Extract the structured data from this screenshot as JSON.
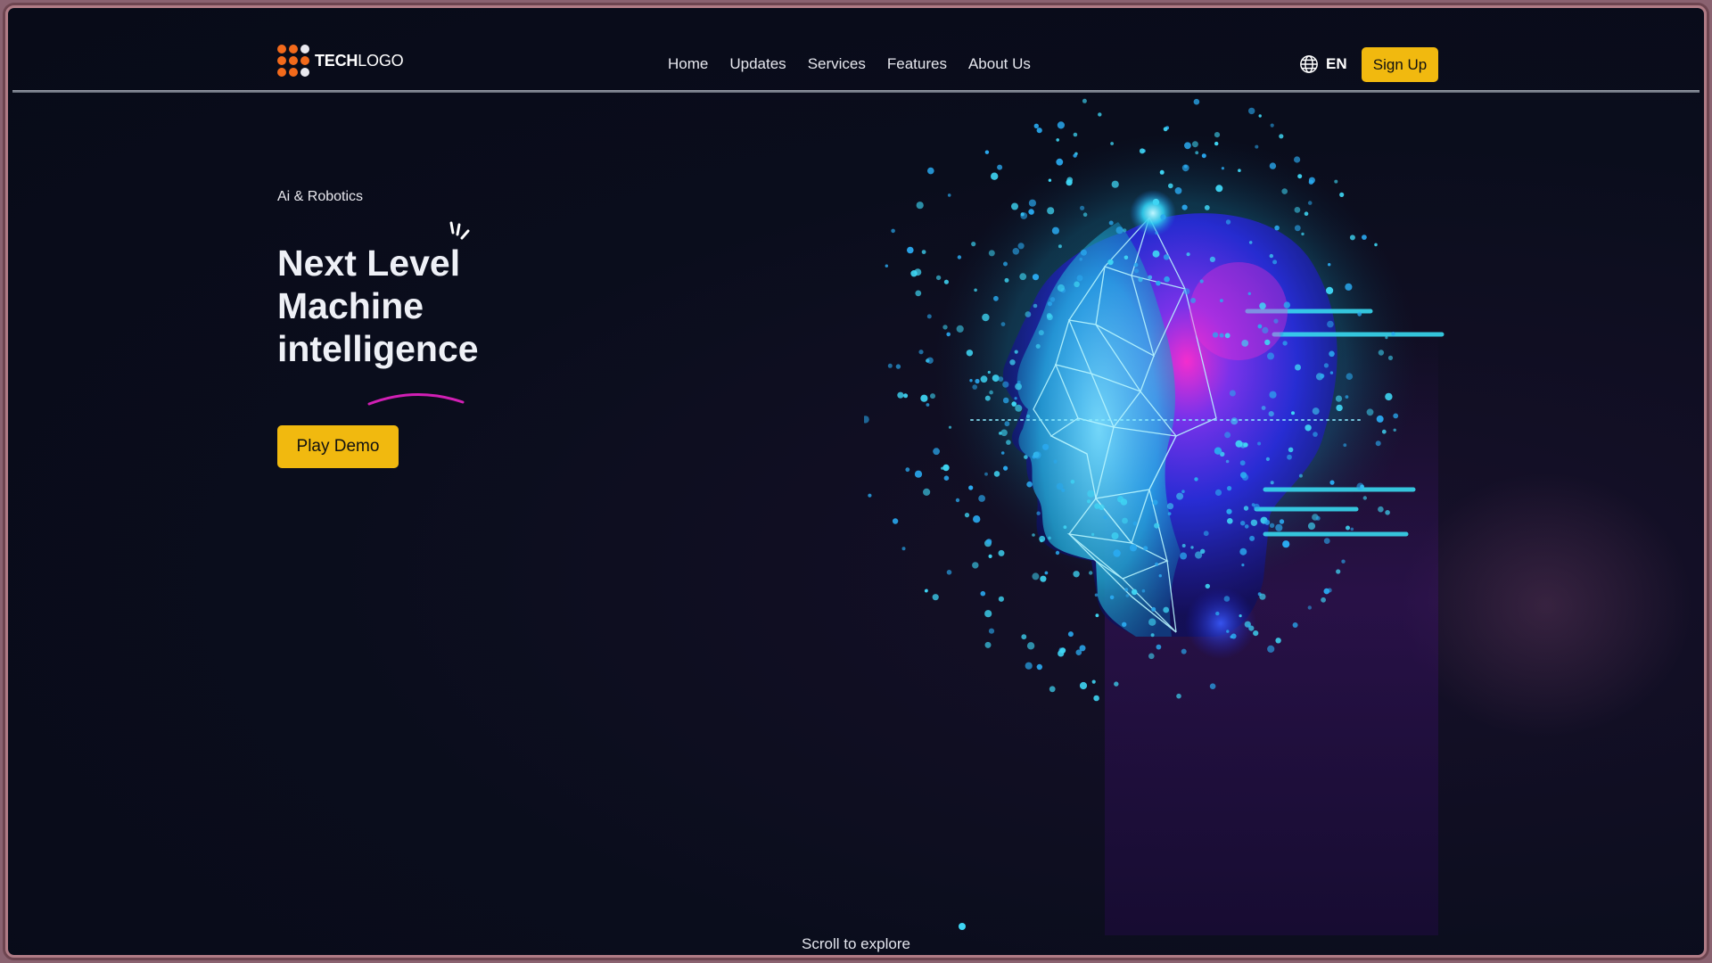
{
  "brand": {
    "bold": "TECH",
    "light": "LOGO"
  },
  "nav": [
    {
      "label": "Home"
    },
    {
      "label": "Updates"
    },
    {
      "label": "Services"
    },
    {
      "label": "Features"
    },
    {
      "label": "About Us"
    }
  ],
  "language": {
    "code": "EN",
    "icon": "globe-icon"
  },
  "signup": {
    "label": "Sign Up"
  },
  "hero": {
    "eyebrow": "Ai & Robotics",
    "headline": [
      "Next Level",
      "Machine",
      "intelligence"
    ],
    "cta": "Play Demo"
  },
  "scroll_hint": "Scroll  to explore",
  "colors": {
    "accent": "#f1b90f",
    "logo_orange": "#f26a1b",
    "logo_light": "#e9e9ef",
    "swoosh": "#d11fb4",
    "background": "#0a0d1c",
    "cyan": "#29d4f0"
  }
}
